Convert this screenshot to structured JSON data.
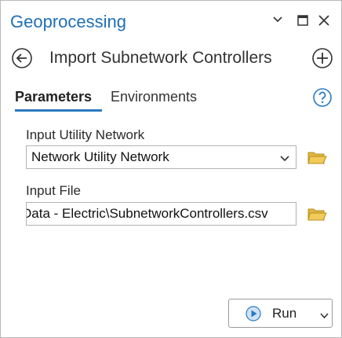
{
  "window": {
    "title": "Geoprocessing",
    "controls": {
      "menu_icon": "chevron-down-icon",
      "max_icon": "maximize-icon",
      "close_icon": "close-icon"
    }
  },
  "tool": {
    "name": "Import Subnetwork Controllers",
    "back_icon": "back-arrow-icon",
    "add_icon": "add-icon"
  },
  "tabs": [
    {
      "label": "Parameters",
      "active": true
    },
    {
      "label": "Environments",
      "active": false
    }
  ],
  "help_icon": "help-icon",
  "parameters": {
    "input_utility_network": {
      "label": "Input Utility Network",
      "value": "Network Utility Network"
    },
    "input_file": {
      "label": "Input File",
      "value": "Data - Electric\\SubnetworkControllers.csv"
    }
  },
  "run_button": {
    "label": "Run"
  },
  "colors": {
    "accent": "#1f6fb5",
    "tab_underline": "#2a7ac0",
    "folder": "#e0b640"
  }
}
